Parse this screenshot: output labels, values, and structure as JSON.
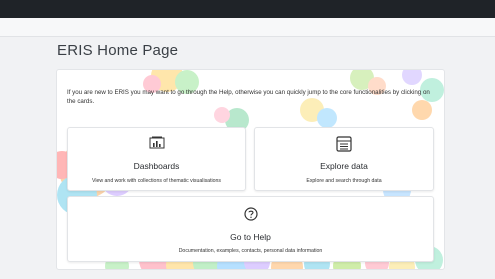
{
  "page": {
    "title": "ERIS Home Page",
    "intro": "If you are new to ERIS you may want to go through the Help, otherwise you can quickly jump to the core functionalities by clicking on the cards."
  },
  "cards": {
    "dashboards": {
      "icon": "dashboard-chart-icon",
      "title": "Dashboards",
      "description": "View and work with collections of thematic visualisations"
    },
    "explore": {
      "icon": "table-list-icon",
      "title": "Explore data",
      "description": "Explore and search through data"
    },
    "help": {
      "icon": "question-circle-icon",
      "title": "Go to Help",
      "description": "Documentation, examples, contacts, personal data information"
    }
  }
}
